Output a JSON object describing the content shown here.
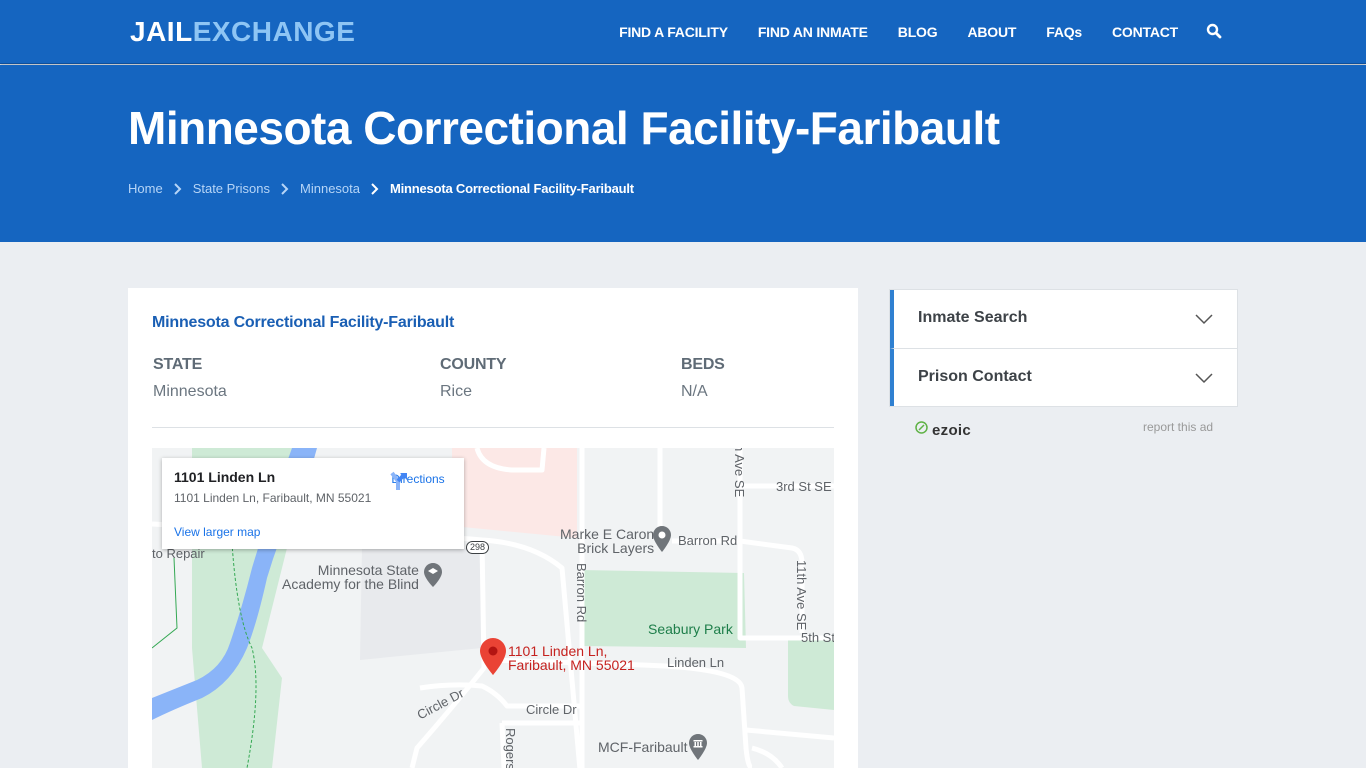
{
  "header": {
    "logo_part1": "JAIL",
    "logo_part2": "EXCHANGE",
    "nav": [
      {
        "label": "FIND A FACILITY"
      },
      {
        "label": "FIND AN INMATE"
      },
      {
        "label": "BLOG"
      },
      {
        "label": "ABOUT"
      },
      {
        "label": "FAQs"
      },
      {
        "label": "CONTACT"
      }
    ],
    "search_icon": "search-icon"
  },
  "hero": {
    "title": "Minnesota Correctional Facility-Faribault",
    "breadcrumb": [
      {
        "label": "Home"
      },
      {
        "label": "State Prisons"
      },
      {
        "label": "Minnesota"
      },
      {
        "label": "Minnesota Correctional Facility-Faribault"
      }
    ]
  },
  "facility": {
    "name": "Minnesota Correctional Facility-Faribault",
    "fields": [
      {
        "label": "STATE",
        "value": "Minnesota"
      },
      {
        "label": "COUNTY",
        "value": "Rice"
      },
      {
        "label": "BEDS",
        "value": "N/A"
      }
    ]
  },
  "map": {
    "infowindow": {
      "title": "1101 Linden Ln",
      "address": "1101 Linden Ln, Faribault, MN 55021",
      "directions_label": "Directions",
      "larger_map_label": "View larger map"
    },
    "pin_label_line1": "1101 Linden Ln,",
    "pin_label_line2": "Faribault, MN 55021",
    "labels": {
      "auto_repair": "to Repair",
      "academy_line1": "Minnesota State",
      "academy_line2": "Academy for the Blind",
      "brick_line1": "Marke E Caron",
      "brick_line2": "Brick Layers",
      "barron_rd": "Barron Rd",
      "barron_rd_vertical": "Barron Rd",
      "third_st": "3rd St SE",
      "ave_se_top": "n Ave SE",
      "eleventh_ave": "11th Ave SE",
      "fifth_st": "5th St",
      "seabury_park": "Seabury Park",
      "linden_ln": "Linden Ln",
      "circle_dr_1": "Circle Dr",
      "circle_dr_2": "Circle Dr",
      "rogers": "Rogers",
      "mcf_faribault": "MCF-Faribault",
      "route_298": "298"
    }
  },
  "sidebar": {
    "accordion": [
      {
        "label": "Inmate Search"
      },
      {
        "label": "Prison Contact"
      }
    ],
    "ad_brand": "ezoic",
    "report_ad": "report this ad"
  },
  "colors": {
    "brand_blue": "#1565c0",
    "logo_accent": "#8ec5f4",
    "link_blue": "#1a5fb4",
    "accordion_accent": "#2f80d1",
    "page_bg": "#ebeef2"
  }
}
